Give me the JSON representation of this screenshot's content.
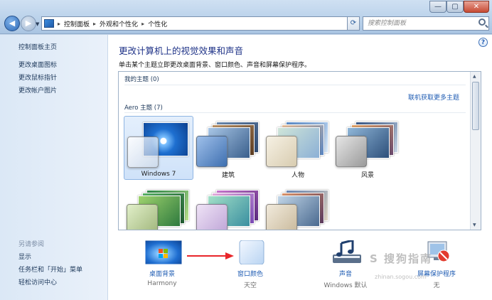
{
  "window": {
    "minimize_label": "—",
    "maximize_label": "▢",
    "close_label": "✕"
  },
  "nav": {
    "back_glyph": "◀",
    "forward_glyph": "▶",
    "recent_glyph": "▼"
  },
  "address": {
    "crumbs": [
      "控制面板",
      "外观和个性化",
      "个性化"
    ],
    "separator": "▸",
    "dropdown_glyph": "▼",
    "refresh_glyph": "⟳"
  },
  "search": {
    "placeholder": "搜索控制面板"
  },
  "sidebar": {
    "items": [
      {
        "label": "控制面板主页"
      },
      {
        "label": "更改桌面图标"
      },
      {
        "label": "更改鼠标指针"
      },
      {
        "label": "更改帐户图片"
      }
    ],
    "see_also_heading": "另请参阅",
    "see_also": [
      {
        "label": "显示"
      },
      {
        "label": "任务栏和「开始」菜单"
      },
      {
        "label": "轻松访问中心"
      }
    ]
  },
  "main": {
    "help_glyph": "?",
    "heading": "更改计算机上的视觉效果和声音",
    "subtitle": "单击某个主题立即更改桌面背景、窗口颜色、声音和屏幕保护程序。",
    "my_themes_label": "我的主题 (0)",
    "online_link": "联机获取更多主题",
    "aero_label": "Aero 主题 (7)",
    "themes": [
      {
        "name": "Windows 7",
        "selected": true
      },
      {
        "name": "建筑"
      },
      {
        "name": "人物"
      },
      {
        "name": "风景"
      },
      {
        "name": ""
      },
      {
        "name": ""
      },
      {
        "name": ""
      }
    ]
  },
  "bottom": {
    "desktop_background": {
      "label": "桌面背景",
      "value": "Harmony"
    },
    "window_color": {
      "label": "窗口颜色",
      "value": "天空"
    },
    "sounds": {
      "label": "声音",
      "value": "Windows 默认"
    },
    "screen_saver": {
      "label": "屏幕保护程序",
      "value": "无"
    }
  },
  "watermark": {
    "text": "S 搜狗指南",
    "sub": "zhinan.sogou.com"
  },
  "colors": {
    "accent_blue": "#1f5cb3",
    "heading_blue": "#1e3287",
    "annotation_arrow": "#e8262a"
  }
}
